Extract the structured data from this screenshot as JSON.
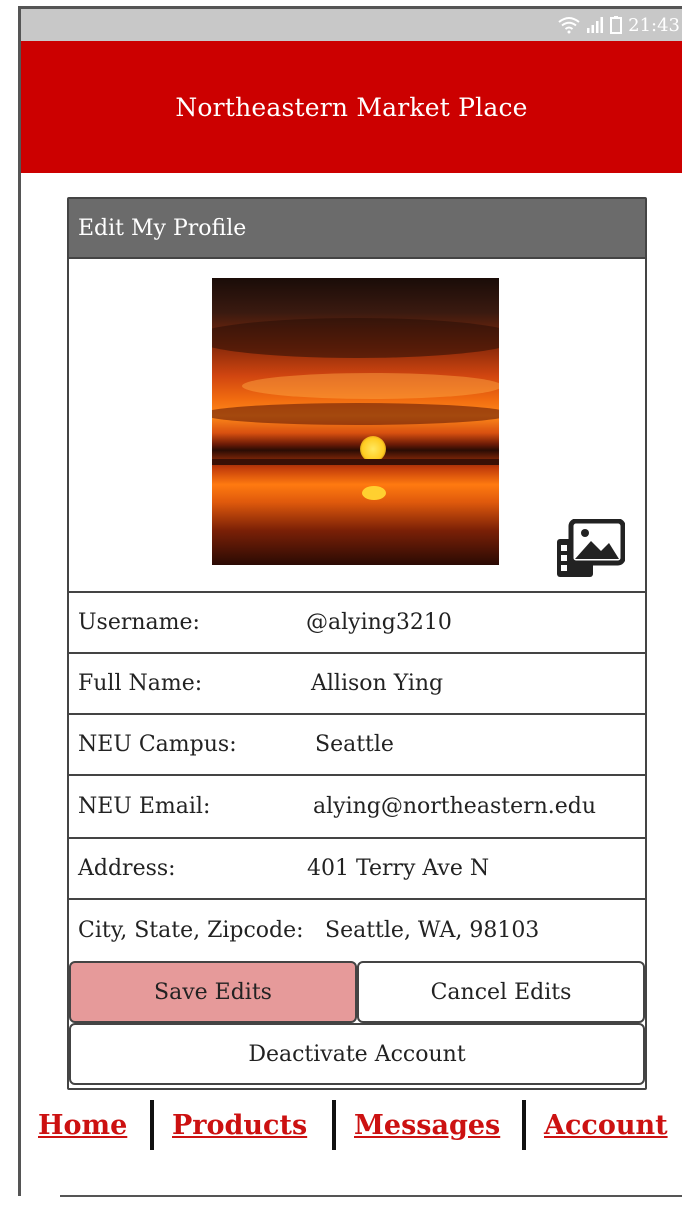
{
  "status_bar": {
    "time": "21:43",
    "wifi_icon": "wifi-icon",
    "signal_icon": "signal-icon",
    "battery_icon": "battery-icon"
  },
  "header": {
    "title": "Northeastern Market Place"
  },
  "card": {
    "title": "Edit My Profile",
    "photo_description": "sunset-photo",
    "gallery_icon": "gallery-icon",
    "fields": [
      {
        "label": "Username:",
        "value": "@alying3210"
      },
      {
        "label": "Full Name:",
        "value": "Allison Ying"
      },
      {
        "label": "NEU Campus:",
        "value": "Seattle"
      },
      {
        "label": "NEU Email:",
        "value": "alying@northeastern.edu"
      },
      {
        "label": "Address:",
        "value": "401 Terry Ave N"
      },
      {
        "label": "City, State, Zipcode:",
        "value": "Seattle, WA, 98103"
      }
    ],
    "buttons": {
      "save": "Save Edits",
      "cancel": "Cancel Edits",
      "deactivate": "Deactivate Account"
    },
    "colors": {
      "header_bg": "#6b6b6b",
      "save_bg": "#e69a9a"
    }
  },
  "nav": {
    "items": [
      "Home",
      "Products",
      "Messages",
      "Account"
    ]
  },
  "colors": {
    "brand": "#cc0000",
    "nav_link": "#cc1111"
  }
}
